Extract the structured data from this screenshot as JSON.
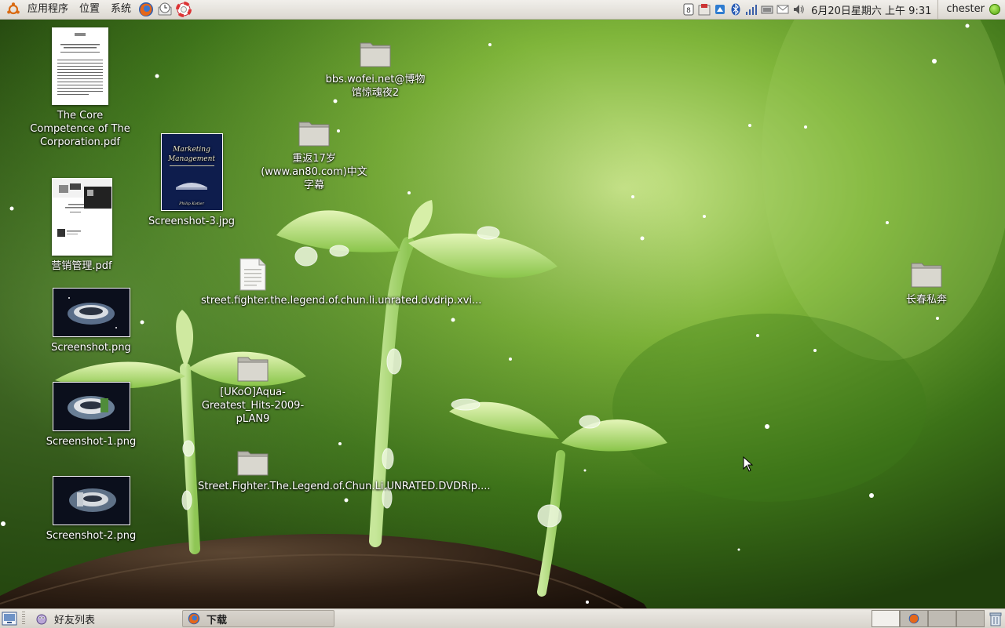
{
  "top_panel": {
    "menus": [
      "应用程序",
      "位置",
      "系统"
    ],
    "clock": "6月20日星期六 上午 9:31",
    "user": "chester"
  },
  "desktop": {
    "files": {
      "core_pdf": "The Core Competence of The Corporation.pdf",
      "yingxiao_pdf": "营销管理.pdf",
      "screenshot": "Screenshot.png",
      "screenshot1": "Screenshot-1.png",
      "screenshot2": "Screenshot-2.png",
      "screenshot3": "Screenshot-3.jpg",
      "sf_file": "street.fighter.the.legend.of.chun.li.unrated.dvdrip.xvi...",
      "aqua_folder": "[UKoO]Aqua-Greatest_Hits-2009-pLAN9",
      "sf_folder": "Street.Fighter.The.Legend.of.Chun.Li.UNRATED.DVDRip....",
      "bbs_folder": "bbs.wofei.net@博物馆惊魂夜2",
      "chongfan_folder": "重返17岁(www.an80.com)中文字幕",
      "changchun_folder": "长春私奔"
    },
    "screenshot3_cover": {
      "title": "Marketing Management",
      "author": "Philip Kotler"
    }
  },
  "bottom_panel": {
    "tasks": [
      "好友列表",
      "下载"
    ]
  },
  "colors": {
    "panel": "#dcd8d1",
    "wallpaper_green": "#6fae2c",
    "soil": "#2a1c12"
  }
}
